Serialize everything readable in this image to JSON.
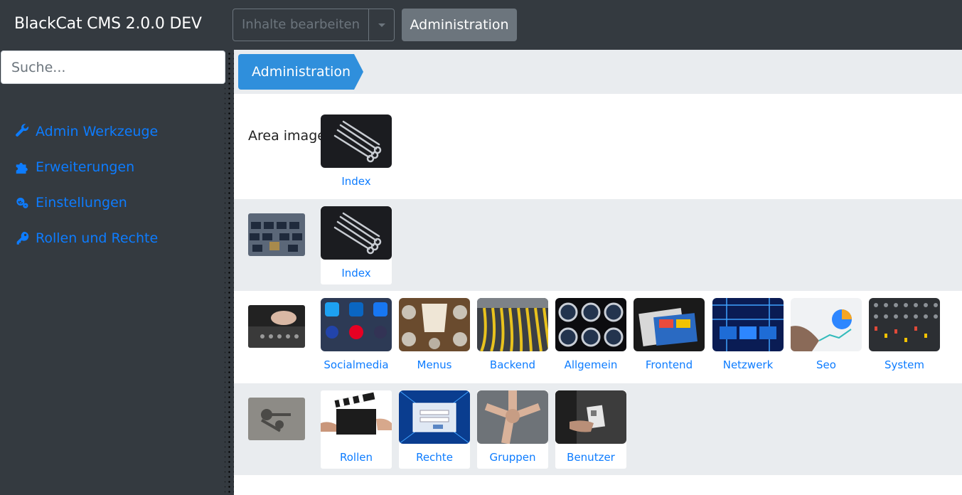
{
  "header": {
    "brand": "BlackCat CMS 2.0.0 DEV",
    "dropdown_label": "Inhalte bearbeiten",
    "admin_button": "Administration"
  },
  "sidebar": {
    "search_placeholder": "Suche...",
    "items": [
      {
        "label": "Admin Werkzeuge",
        "icon": "wrench-icon"
      },
      {
        "label": "Erweiterungen",
        "icon": "puzzle-icon"
      },
      {
        "label": "Einstellungen",
        "icon": "cogs-icon"
      },
      {
        "label": "Rollen und Rechte",
        "icon": "key-icon"
      }
    ]
  },
  "breadcrumb": {
    "label": "Administration"
  },
  "rows": [
    {
      "area_label": "Area image",
      "tiles": [
        {
          "label": "Index"
        }
      ]
    },
    {
      "tiles": [
        {
          "label": "Index"
        }
      ]
    },
    {
      "tiles": [
        {
          "label": "Socialmedia"
        },
        {
          "label": "Menus"
        },
        {
          "label": "Backend"
        },
        {
          "label": "Allgemein"
        },
        {
          "label": "Frontend"
        },
        {
          "label": "Netzwerk"
        },
        {
          "label": "Seo"
        },
        {
          "label": "System"
        }
      ]
    },
    {
      "tiles": [
        {
          "label": "Rollen"
        },
        {
          "label": "Rechte"
        },
        {
          "label": "Gruppen"
        },
        {
          "label": "Benutzer"
        }
      ]
    }
  ],
  "colors": {
    "topbar": "#343a40",
    "accent": "#0d7cff",
    "breadcrumb": "#2f8fdc",
    "row_alt": "#e9ecef"
  }
}
